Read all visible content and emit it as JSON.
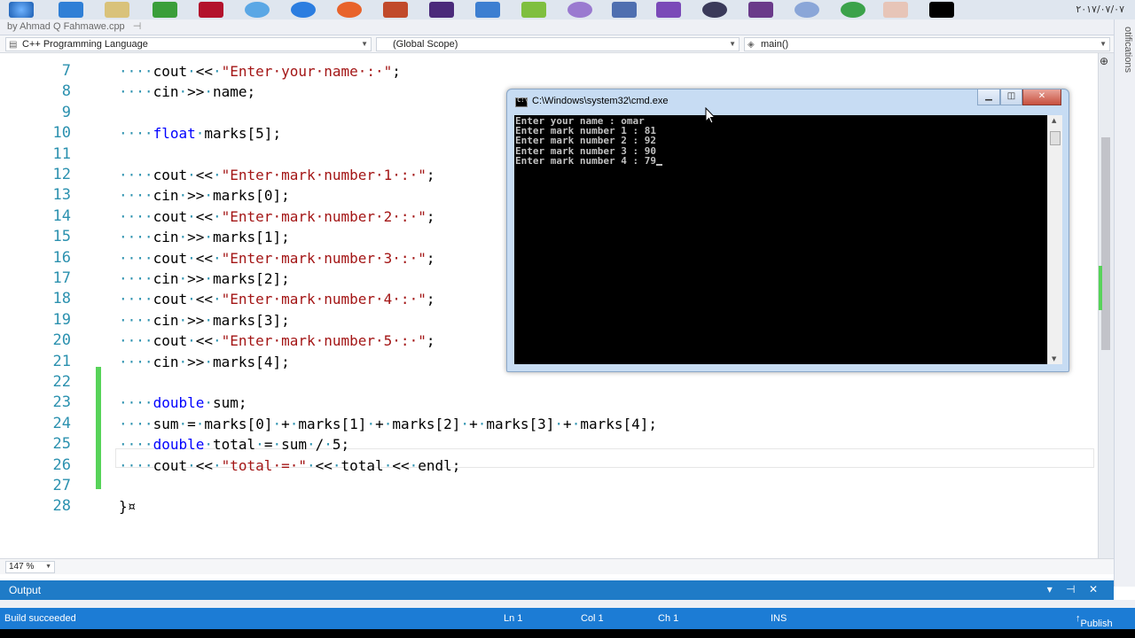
{
  "file_tab": {
    "title": "by Ahmad Q Fahmawe.cpp",
    "pin": "⊣"
  },
  "clock": "٢٠١٧/٠٧/٠٧",
  "notifications_label": "otifications",
  "navbar": {
    "project": "C++ Programming Language",
    "scope": "(Global Scope)",
    "member": "main()"
  },
  "editor": {
    "lines": [
      {
        "num": "7",
        "code": "····cout·<<·\"Enter·your·name·:·\";"
      },
      {
        "num": "8",
        "code": "····cin·>>·name;"
      },
      {
        "num": "9",
        "code": ""
      },
      {
        "num": "10",
        "code": "····float·marks[5];"
      },
      {
        "num": "11",
        "code": ""
      },
      {
        "num": "12",
        "code": "····cout·<<·\"Enter·mark·number·1·:·\";"
      },
      {
        "num": "13",
        "code": "····cin·>>·marks[0];"
      },
      {
        "num": "14",
        "code": "····cout·<<·\"Enter·mark·number·2·:·\";"
      },
      {
        "num": "15",
        "code": "····cin·>>·marks[1];"
      },
      {
        "num": "16",
        "code": "····cout·<<·\"Enter·mark·number·3·:·\";"
      },
      {
        "num": "17",
        "code": "····cin·>>·marks[2];"
      },
      {
        "num": "18",
        "code": "····cout·<<·\"Enter·mark·number·4·:·\";"
      },
      {
        "num": "19",
        "code": "····cin·>>·marks[3];"
      },
      {
        "num": "20",
        "code": "····cout·<<·\"Enter·mark·number·5·:·\";"
      },
      {
        "num": "21",
        "code": "····cin·>>·marks[4];"
      },
      {
        "num": "22",
        "code": ""
      },
      {
        "num": "23",
        "code": "····double·sum;"
      },
      {
        "num": "24",
        "code": "····sum·=·marks[0]·+·marks[1]·+·marks[2]·+·marks[3]·+·marks[4];"
      },
      {
        "num": "25",
        "code": "····double·total·=·sum·/·5;"
      },
      {
        "num": "26",
        "code": "····cout·<<·\"total·=·\"·<<·total·<<·endl;"
      },
      {
        "num": "27",
        "code": ""
      },
      {
        "num": "28",
        "code": "}¤"
      }
    ]
  },
  "zoom": "147 %",
  "output_panel": {
    "title": "Output",
    "buttons": "▾ ⊣ ✕"
  },
  "status": {
    "message": "Build succeeded",
    "ln": "Ln 1",
    "col": "Col 1",
    "ch": "Ch 1",
    "mode": "INS",
    "publish": "Publish"
  },
  "cmd": {
    "title": "C:\\Windows\\system32\\cmd.exe",
    "icon_text": "C:\\",
    "output": [
      "Enter your name : omar",
      "Enter mark number 1 : 81",
      "Enter mark number 2 : 92",
      "Enter mark number 3 : 90",
      "Enter mark number 4 : 79"
    ]
  },
  "colors": {
    "keyword": "#0000ff",
    "string": "#a31515",
    "line_number": "#2b91af",
    "change_bar": "#57d359",
    "status_bar": "#1c7cd5"
  }
}
